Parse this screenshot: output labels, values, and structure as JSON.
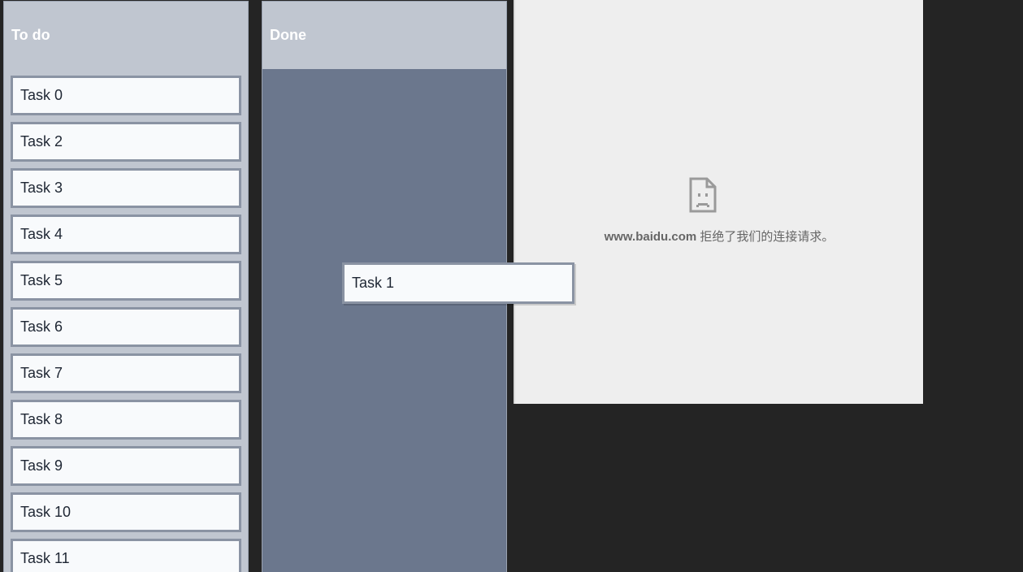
{
  "columns": {
    "todo": {
      "title": "To do",
      "tasks": [
        "Task 0",
        "Task 2",
        "Task 3",
        "Task 4",
        "Task 5",
        "Task 6",
        "Task 7",
        "Task 8",
        "Task 9",
        "Task 10",
        "Task 11"
      ]
    },
    "done": {
      "title": "Done",
      "tasks": []
    }
  },
  "dragging_task": {
    "label": "Task 1"
  },
  "error_page": {
    "icon": "sad-document-icon",
    "domain": "www.baidu.com",
    "message": " 拒绝了我们的连接请求。"
  },
  "colors": {
    "background": "#242424",
    "column_bg": "#c0c6d0",
    "drop_zone_bg": "#6b778d",
    "task_bg": "#f8fafc",
    "task_border": "#8a93a3",
    "error_bg": "#eeeeee"
  }
}
